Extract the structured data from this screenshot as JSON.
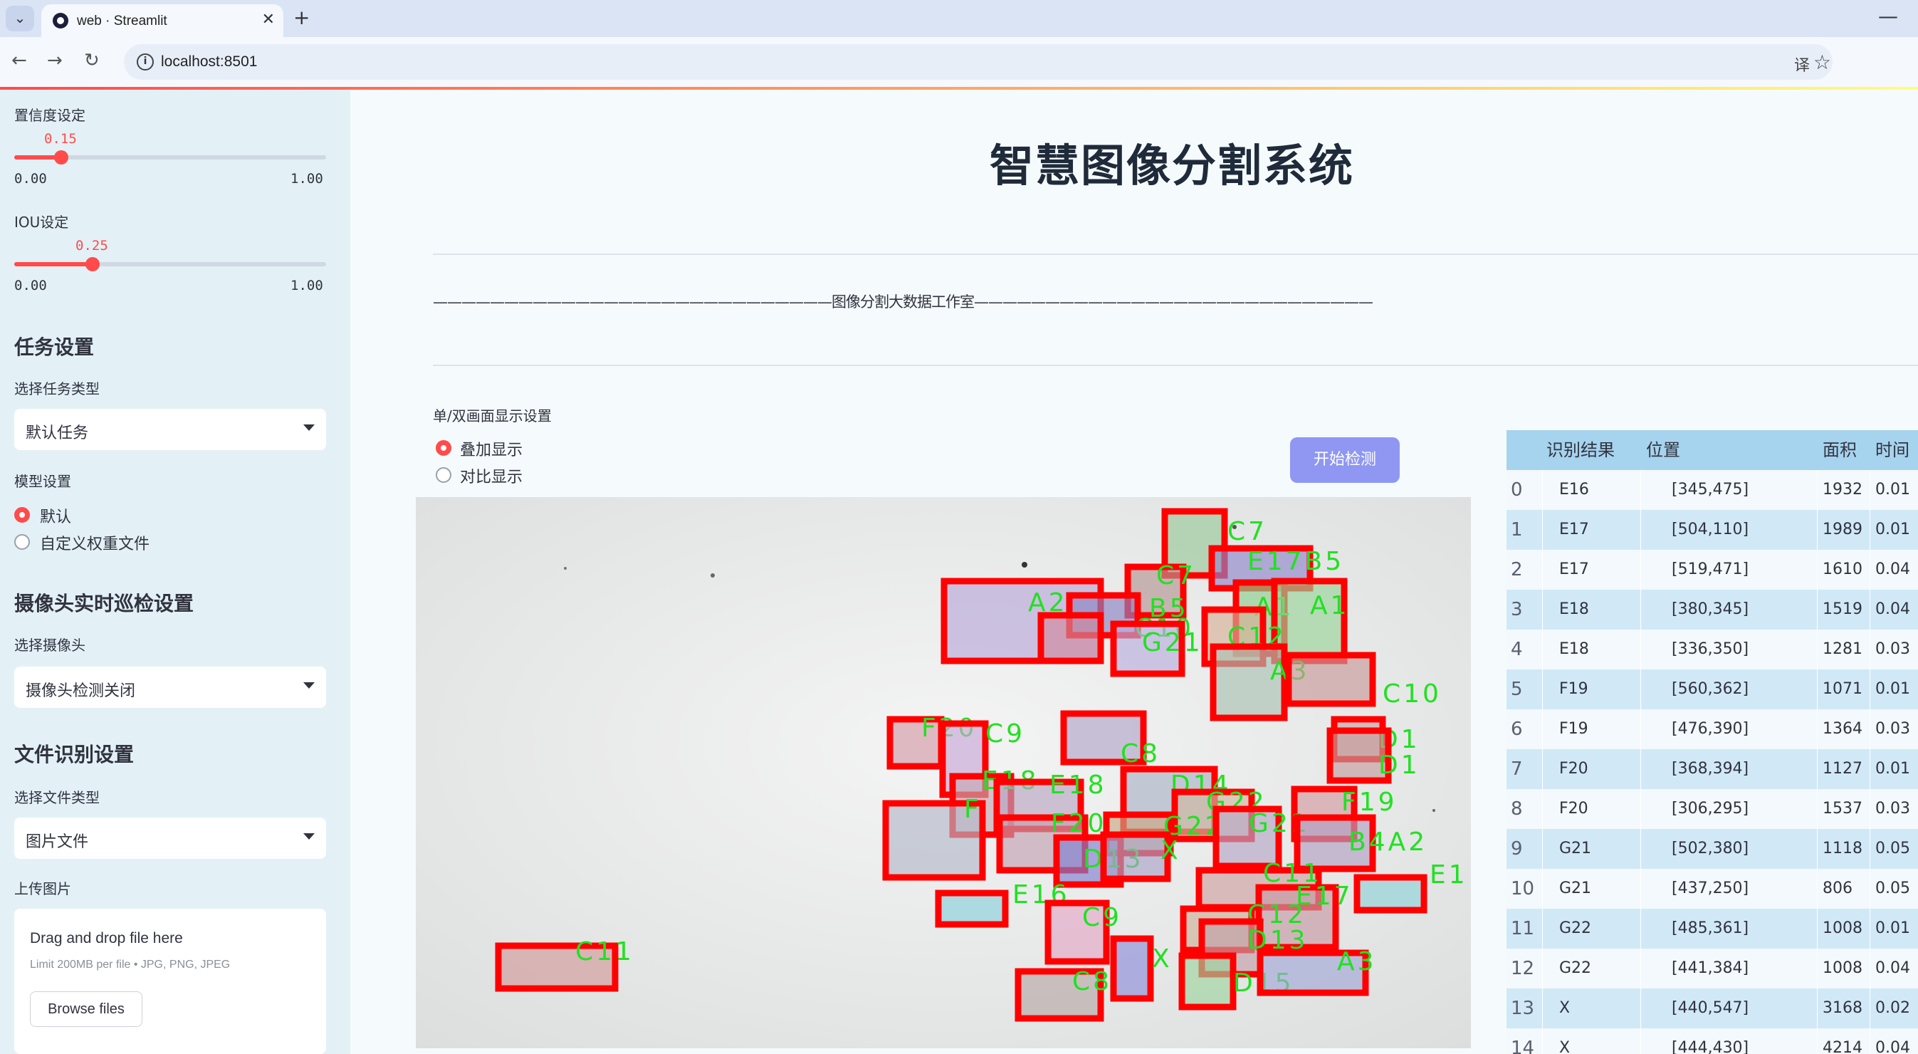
{
  "browser": {
    "tab_title": "web · Streamlit",
    "url": "localhost:8501"
  },
  "sidebar": {
    "confidence": {
      "label": "置信度设定",
      "value": "0.15",
      "min": "0.00",
      "max": "1.00",
      "fraction": 0.15
    },
    "iou": {
      "label": "IOU设定",
      "value": "0.25",
      "min": "0.00",
      "max": "1.00",
      "fraction": 0.25
    },
    "task": {
      "heading": "任务设置",
      "label": "选择任务类型",
      "selected": "默认任务"
    },
    "model": {
      "label": "模型设置",
      "options": [
        "默认",
        "自定义权重文件"
      ],
      "selected_index": 0
    },
    "camera": {
      "heading": "摄像头实时巡检设置",
      "label": "选择摄像头",
      "selected": "摄像头检测关闭"
    },
    "file": {
      "heading": "文件识别设置",
      "label": "选择文件类型",
      "selected": "图片文件"
    },
    "upload": {
      "label": "上传图片",
      "title": "Drag and drop file here",
      "subtitle": "Limit 200MB per file • JPG, PNG, JPEG",
      "button": "Browse files"
    }
  },
  "main": {
    "title": "智慧图像分割系统",
    "studio": "————————————————————————————图像分割大数据工作室————————————————————————————",
    "display_label": "单/双画面显示设置",
    "display_options": [
      "叠加显示",
      "对比显示"
    ],
    "display_selected_index": 0,
    "start_button": "开始检测"
  },
  "detections": [
    {
      "label": "C7",
      "fill": "#9ac79a"
    },
    {
      "label": "E17B5",
      "fill": "#8f86c9"
    },
    {
      "label": "C7",
      "fill": "#b59494"
    },
    {
      "label": "A2",
      "fill": "#b8a7d8"
    },
    {
      "label": "B5",
      "fill": "#8a82c2"
    },
    {
      "label": "A1",
      "fill": "#8ecf8e"
    },
    {
      "label": "A1",
      "fill": "#98d498"
    },
    {
      "label": "C10",
      "fill": "#d08a9e"
    },
    {
      "label": "C12",
      "fill": "#d7b096"
    },
    {
      "label": "G21",
      "fill": "#b9aedb"
    },
    {
      "label": "A3",
      "fill": "#a9c2b4"
    },
    {
      "label": "C10",
      "fill": "#c99a9a"
    },
    {
      "label": "F20",
      "fill": "#d49aa8"
    },
    {
      "label": "C9",
      "fill": "#c6a8d6"
    },
    {
      "label": "C8",
      "fill": "#b0a4c8"
    },
    {
      "label": "D1",
      "fill": "#c9a5a5"
    },
    {
      "label": "D1",
      "fill": "#c59c9c"
    },
    {
      "label": "E18",
      "fill": "#c4a7b2"
    },
    {
      "label": "E18",
      "fill": "#b9a5c2"
    },
    {
      "label": "D14",
      "fill": "#aab2c6"
    },
    {
      "label": "G22",
      "fill": "#d0b9a0"
    },
    {
      "label": "F19",
      "fill": "#d29aa0"
    },
    {
      "label": "F",
      "fill": "#b3b8c8"
    },
    {
      "label": "F20",
      "fill": "#c2a0b0"
    },
    {
      "label": "G22",
      "fill": "#c9a883"
    },
    {
      "label": "G21",
      "fill": "#b7a6c6"
    },
    {
      "label": "B4A2",
      "fill": "#b2a0c2"
    },
    {
      "label": "D13",
      "fill": "#7f7fd0"
    },
    {
      "label": "X",
      "fill": "#a8a3c8"
    },
    {
      "label": "C11",
      "fill": "#d1a2a2"
    },
    {
      "label": "E1",
      "fill": "#8fd3d8"
    },
    {
      "label": "E16",
      "fill": "#8ccfda"
    },
    {
      "label": "E17",
      "fill": "#c69aa4"
    },
    {
      "label": "C9",
      "fill": "#e4a8c6"
    },
    {
      "label": "C12",
      "fill": "#ccb09a"
    },
    {
      "label": "D13",
      "fill": "#c3a0a8"
    },
    {
      "label": "X",
      "fill": "#8e8ed8"
    },
    {
      "label": "C8",
      "fill": "#b8a7a7"
    },
    {
      "label": "D15",
      "fill": "#9ed49e"
    },
    {
      "label": "A3",
      "fill": "#a2a8d6"
    },
    {
      "label": "C11",
      "fill": "#d29a9a"
    }
  ],
  "table": {
    "headers": [
      "识别结果",
      "位置",
      "面积",
      "时间"
    ],
    "rows": [
      {
        "idx": "0",
        "result": "E16",
        "position": "[345,475]",
        "area": "1932",
        "time": "0.01"
      },
      {
        "idx": "1",
        "result": "E17",
        "position": "[504,110]",
        "area": "1989",
        "time": "0.01"
      },
      {
        "idx": "2",
        "result": "E17",
        "position": "[519,471]",
        "area": "1610",
        "time": "0.04"
      },
      {
        "idx": "3",
        "result": "E18",
        "position": "[380,345]",
        "area": "1519",
        "time": "0.04"
      },
      {
        "idx": "4",
        "result": "E18",
        "position": "[336,350]",
        "area": "1281",
        "time": "0.03"
      },
      {
        "idx": "5",
        "result": "F19",
        "position": "[560,362]",
        "area": "1071",
        "time": "0.01"
      },
      {
        "idx": "6",
        "result": "F19",
        "position": "[476,390]",
        "area": "1364",
        "time": "0.03"
      },
      {
        "idx": "7",
        "result": "F20",
        "position": "[368,394]",
        "area": "1127",
        "time": "0.01"
      },
      {
        "idx": "8",
        "result": "F20",
        "position": "[306,295]",
        "area": "1537",
        "time": "0.03"
      },
      {
        "idx": "9",
        "result": "G21",
        "position": "[502,380]",
        "area": "1118",
        "time": "0.05"
      },
      {
        "idx": "10",
        "result": "G21",
        "position": "[437,250]",
        "area": "806",
        "time": "0.05"
      },
      {
        "idx": "11",
        "result": "G22",
        "position": "[485,361]",
        "area": "1008",
        "time": "0.01"
      },
      {
        "idx": "12",
        "result": "G22",
        "position": "[441,384]",
        "area": "1008",
        "time": "0.04"
      },
      {
        "idx": "13",
        "result": "X",
        "position": "[440,547]",
        "area": "3168",
        "time": "0.02"
      },
      {
        "idx": "14",
        "result": "X",
        "position": "[444,430]",
        "area": "4214",
        "time": "0.04"
      }
    ]
  }
}
